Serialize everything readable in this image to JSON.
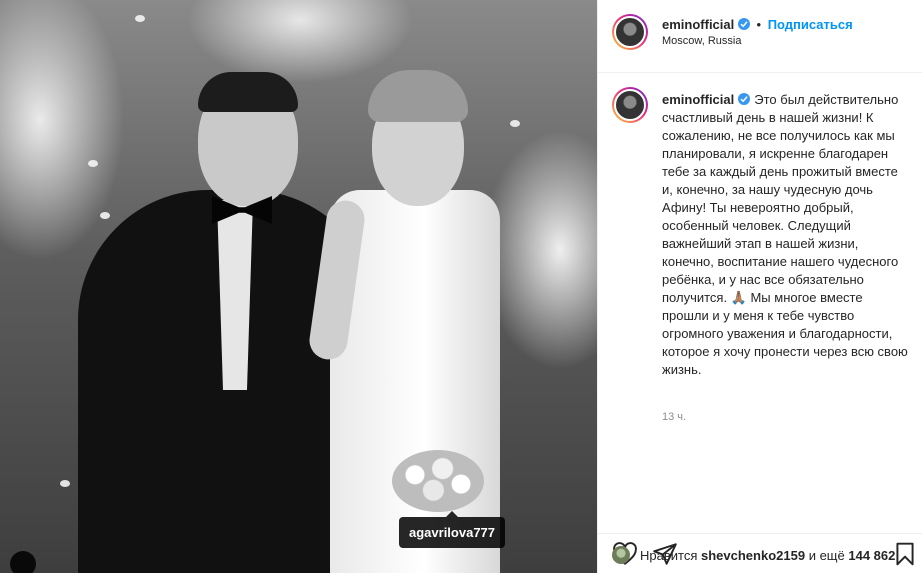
{
  "post": {
    "tagged_user": "agavrilova777"
  },
  "header": {
    "username": "eminofficial",
    "separator": "•",
    "follow_label": "Подписаться",
    "location": "Moscow, Russia"
  },
  "caption": {
    "username": "eminofficial",
    "text": "Это был действительно счастливый день в нашей жизни! К сожалению, не все получилось как мы планировали, я искренне благодарен тебе за каждый день прожитый вместе и, конечно, за нашу чудесную дочь Афину! Ты невероятно добрый, особенный человек. Следущий важнейший этап в нашей жизни, конечно, воспитание нашего чудесного ребёнка, и у нас все обязательно получится. 🙏🏽 Мы многое вместе прошли и у меня к тебе чувство огромного уважения и благодарности, которое я хочу пронести через всю свою жизнь.",
    "timestamp": "13 ч."
  },
  "likes": {
    "prefix": "Нравится",
    "liker": "shevchenko2159",
    "conjunction": "и ещё",
    "count": "144 862"
  },
  "icons": {
    "like": "heart-icon",
    "share": "paper-plane-icon",
    "save": "bookmark-icon",
    "verified": "verified-badge-icon",
    "tagged_users": "user-tag-icon"
  },
  "colors": {
    "accent": "#0095f6",
    "verified": "#3897f0",
    "muted": "#8e8e8e",
    "text": "#262626"
  }
}
